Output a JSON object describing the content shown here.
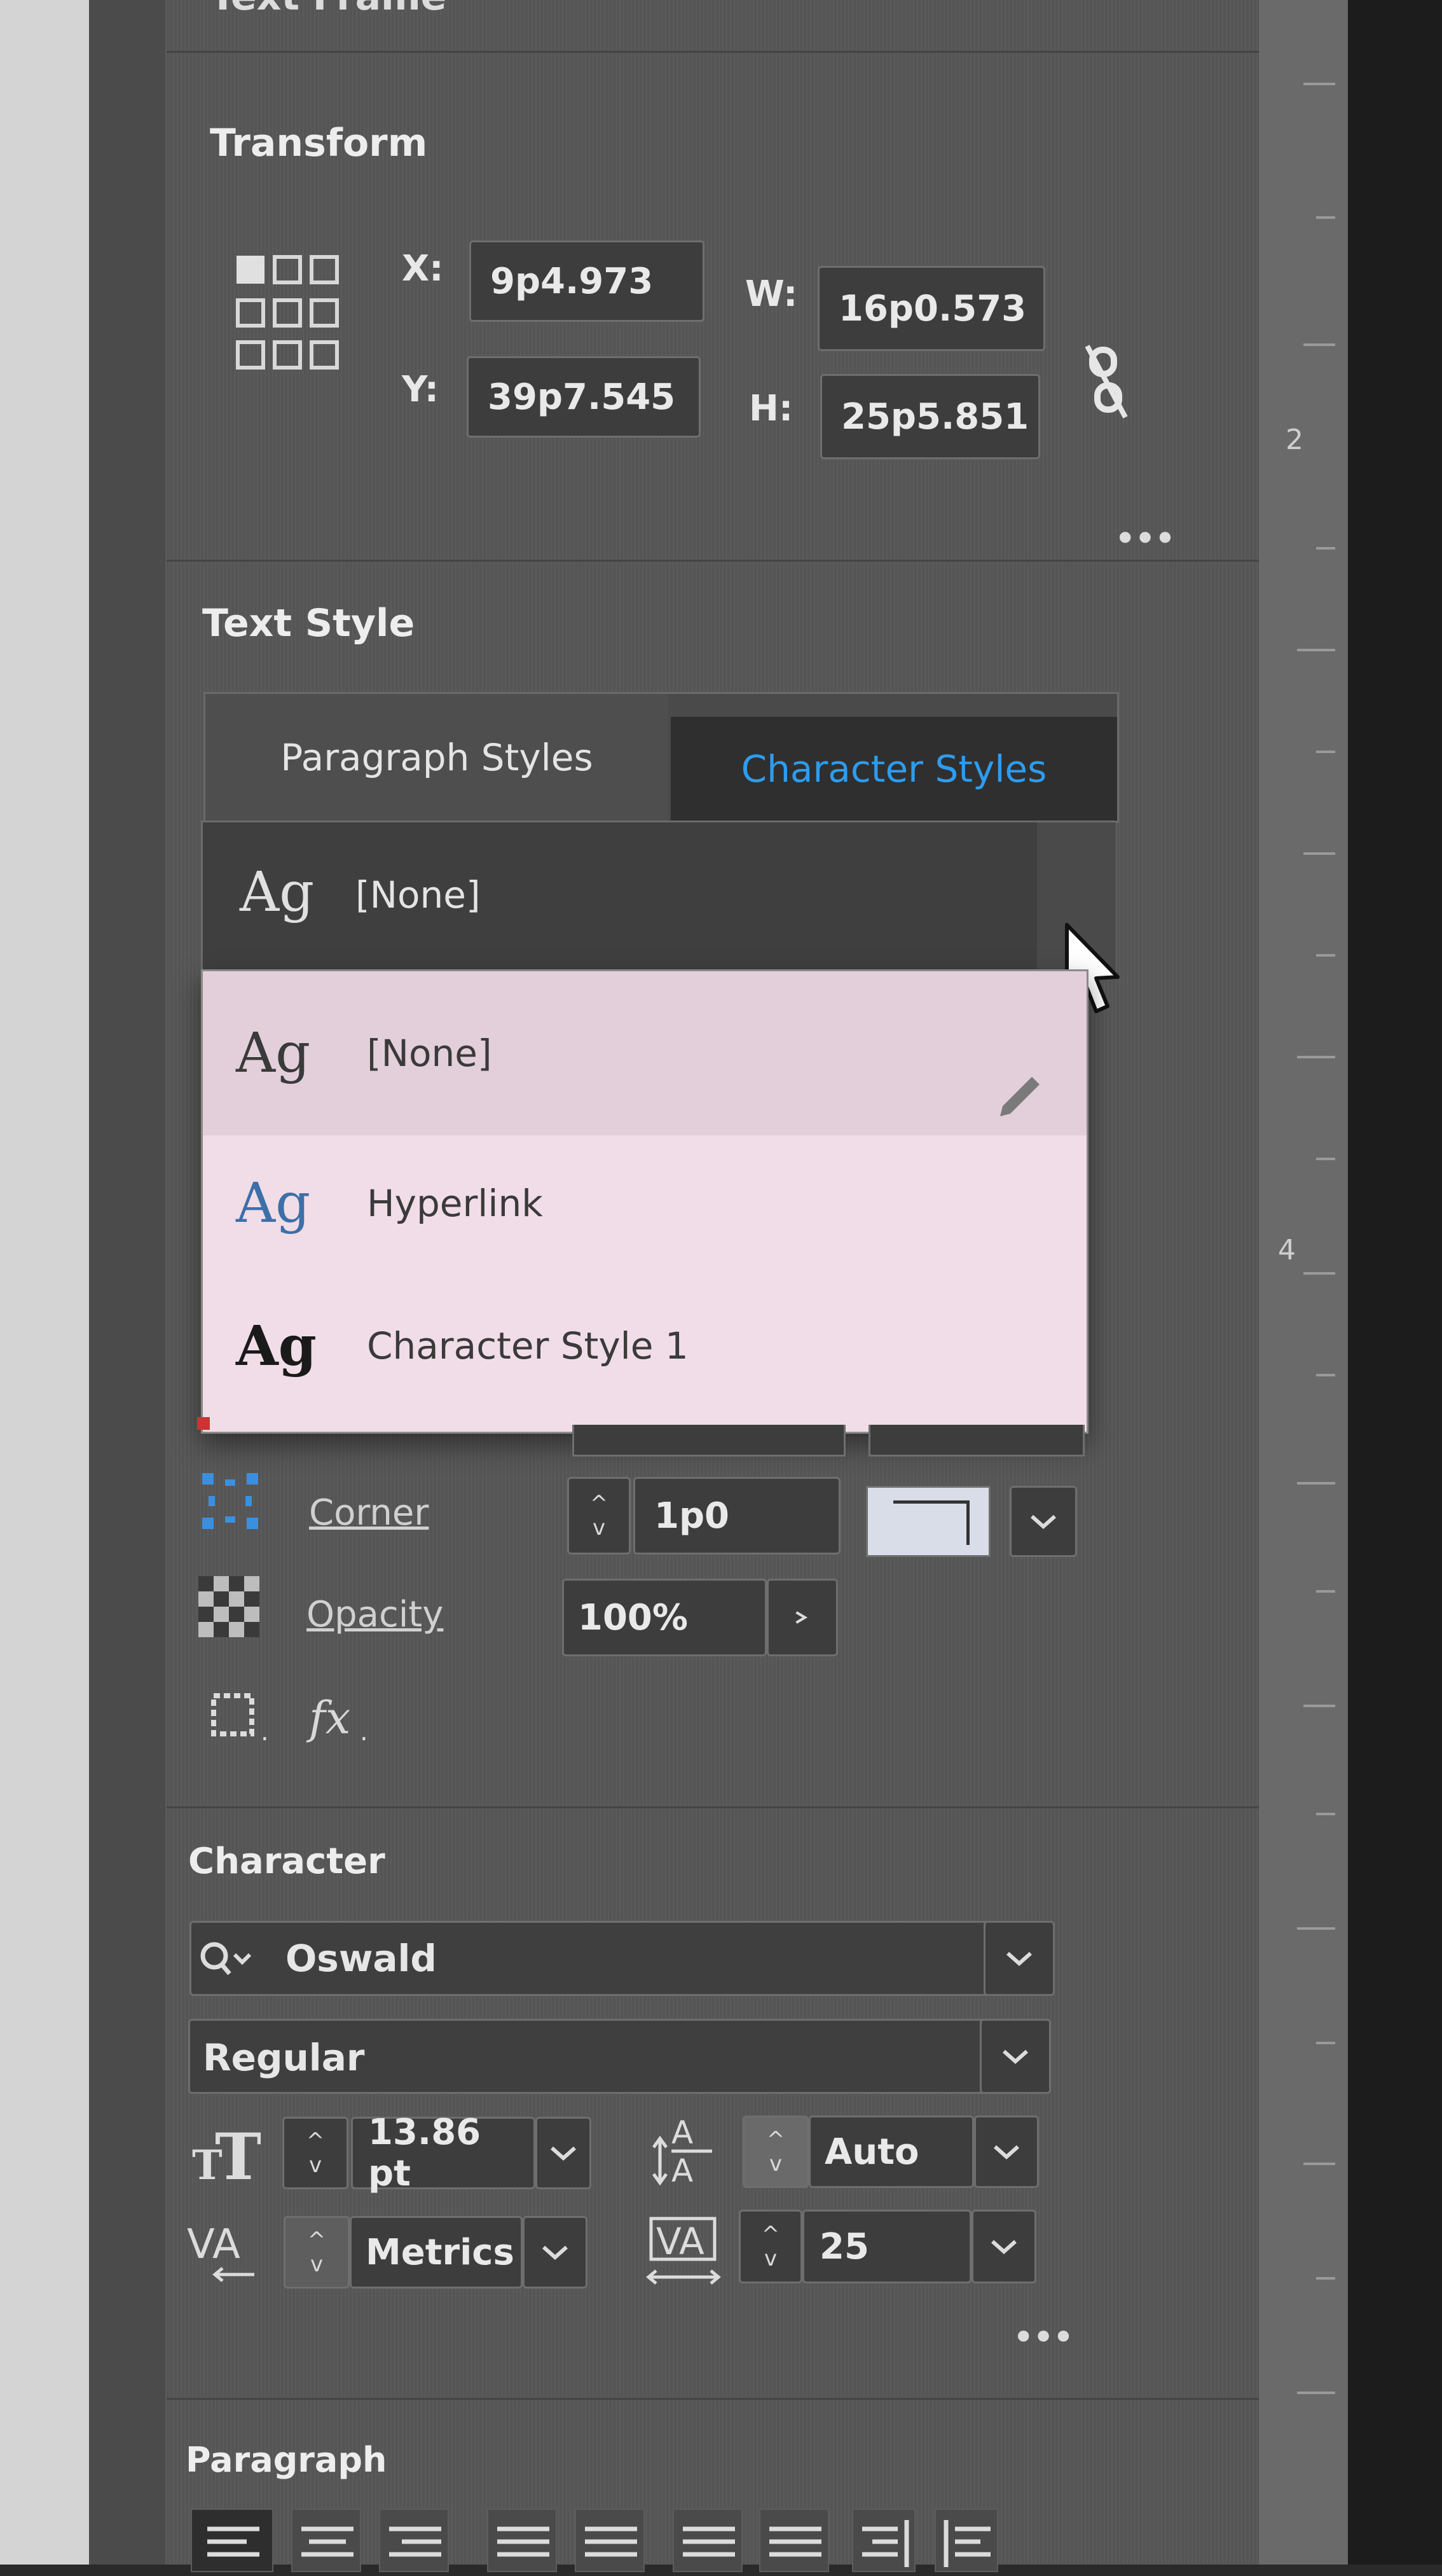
{
  "panel": {
    "header_partial": "Text Frame",
    "transform": {
      "title": "Transform",
      "x_label": "X:",
      "x_value": "9p4.973",
      "y_label": "Y:",
      "y_value": "39p7.545",
      "w_label": "W:",
      "w_value": "16p0.573",
      "h_label": "H:",
      "h_value": "25p5.851",
      "more": "•••"
    },
    "text_style": {
      "title": "Text Style",
      "tabs": [
        {
          "label": "Paragraph Styles",
          "active": false
        },
        {
          "label": "Character Styles",
          "active": true
        }
      ],
      "selected": {
        "icon_text": "Ag",
        "label": "[None]"
      },
      "dropdown_items": [
        {
          "icon_text": "Ag",
          "label": "[None]",
          "color": "#3a3a3a"
        },
        {
          "icon_text": "Ag",
          "label": "Hyperlink",
          "color": "#3d6fa8"
        },
        {
          "icon_text": "Ag",
          "label": "Character Style 1",
          "color": "#1a1a1a"
        }
      ]
    },
    "appearance": {
      "corner_label": "Corner",
      "corner_value": "1p0",
      "opacity_label": "Opacity",
      "opacity_value": "100%"
    },
    "character": {
      "title": "Character",
      "font_family": "Oswald",
      "font_style": "Regular",
      "font_size": "13.86 pt",
      "leading": "Auto",
      "kerning": "Metrics",
      "tracking": "25",
      "more": "•••"
    },
    "paragraph": {
      "title": "Paragraph"
    }
  },
  "ruler": {
    "numbers": [
      "2",
      "4"
    ]
  },
  "colors": {
    "accent": "#2d9cf0",
    "panel_bg": "#555555",
    "menu_bg": "#f1dde7"
  }
}
